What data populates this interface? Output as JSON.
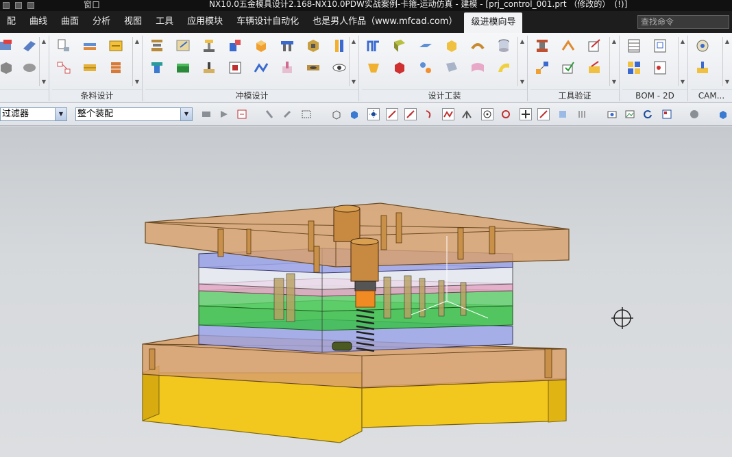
{
  "titlebar": {
    "window_menu": "窗口",
    "title": "NX10.0五金模具设计2.168-NX10.0PDW实战案例-卡箍-运动仿真 - 建模 - [prj_control_001.prt （修改的）　(!)]"
  },
  "menubar": {
    "items": [
      "配",
      "曲线",
      "曲面",
      "分析",
      "视图",
      "工具",
      "应用模块",
      "车辆设计自动化",
      "也是男人作品（www.mfcad.com）",
      "级进模向导"
    ],
    "active": "级进模向导",
    "search_placeholder": "查找命令"
  },
  "ribbon": {
    "groups": [
      {
        "label": ""
      },
      {
        "label": "条料设计"
      },
      {
        "label": "冲模设计"
      },
      {
        "label": "设计工装"
      },
      {
        "label": "工具验证"
      },
      {
        "label": "BOM - 2D"
      },
      {
        "label": "CAM..."
      }
    ]
  },
  "selection_bar": {
    "filter": "过滤器",
    "scope": "整个装配"
  },
  "colors": {
    "top_plate": "#d9a06a",
    "blue_plate": "#9aa2e8",
    "green_plate": "#3bbf4a",
    "pink_plate": "#e8a8c8",
    "base_legs": "#f2c81e",
    "spring_orange": "#f08a22"
  }
}
